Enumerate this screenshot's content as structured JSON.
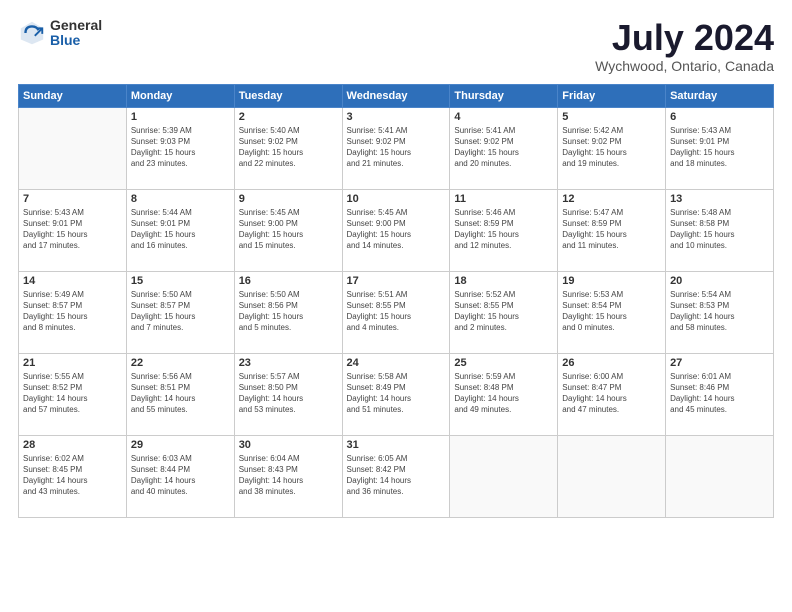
{
  "logo": {
    "general": "General",
    "blue": "Blue"
  },
  "title": "July 2024",
  "location": "Wychwood, Ontario, Canada",
  "days_of_week": [
    "Sunday",
    "Monday",
    "Tuesday",
    "Wednesday",
    "Thursday",
    "Friday",
    "Saturday"
  ],
  "weeks": [
    [
      {
        "day": "",
        "info": ""
      },
      {
        "day": "1",
        "info": "Sunrise: 5:39 AM\nSunset: 9:03 PM\nDaylight: 15 hours\nand 23 minutes."
      },
      {
        "day": "2",
        "info": "Sunrise: 5:40 AM\nSunset: 9:02 PM\nDaylight: 15 hours\nand 22 minutes."
      },
      {
        "day": "3",
        "info": "Sunrise: 5:41 AM\nSunset: 9:02 PM\nDaylight: 15 hours\nand 21 minutes."
      },
      {
        "day": "4",
        "info": "Sunrise: 5:41 AM\nSunset: 9:02 PM\nDaylight: 15 hours\nand 20 minutes."
      },
      {
        "day": "5",
        "info": "Sunrise: 5:42 AM\nSunset: 9:02 PM\nDaylight: 15 hours\nand 19 minutes."
      },
      {
        "day": "6",
        "info": "Sunrise: 5:43 AM\nSunset: 9:01 PM\nDaylight: 15 hours\nand 18 minutes."
      }
    ],
    [
      {
        "day": "7",
        "info": "Sunrise: 5:43 AM\nSunset: 9:01 PM\nDaylight: 15 hours\nand 17 minutes."
      },
      {
        "day": "8",
        "info": "Sunrise: 5:44 AM\nSunset: 9:01 PM\nDaylight: 15 hours\nand 16 minutes."
      },
      {
        "day": "9",
        "info": "Sunrise: 5:45 AM\nSunset: 9:00 PM\nDaylight: 15 hours\nand 15 minutes."
      },
      {
        "day": "10",
        "info": "Sunrise: 5:45 AM\nSunset: 9:00 PM\nDaylight: 15 hours\nand 14 minutes."
      },
      {
        "day": "11",
        "info": "Sunrise: 5:46 AM\nSunset: 8:59 PM\nDaylight: 15 hours\nand 12 minutes."
      },
      {
        "day": "12",
        "info": "Sunrise: 5:47 AM\nSunset: 8:59 PM\nDaylight: 15 hours\nand 11 minutes."
      },
      {
        "day": "13",
        "info": "Sunrise: 5:48 AM\nSunset: 8:58 PM\nDaylight: 15 hours\nand 10 minutes."
      }
    ],
    [
      {
        "day": "14",
        "info": "Sunrise: 5:49 AM\nSunset: 8:57 PM\nDaylight: 15 hours\nand 8 minutes."
      },
      {
        "day": "15",
        "info": "Sunrise: 5:50 AM\nSunset: 8:57 PM\nDaylight: 15 hours\nand 7 minutes."
      },
      {
        "day": "16",
        "info": "Sunrise: 5:50 AM\nSunset: 8:56 PM\nDaylight: 15 hours\nand 5 minutes."
      },
      {
        "day": "17",
        "info": "Sunrise: 5:51 AM\nSunset: 8:55 PM\nDaylight: 15 hours\nand 4 minutes."
      },
      {
        "day": "18",
        "info": "Sunrise: 5:52 AM\nSunset: 8:55 PM\nDaylight: 15 hours\nand 2 minutes."
      },
      {
        "day": "19",
        "info": "Sunrise: 5:53 AM\nSunset: 8:54 PM\nDaylight: 15 hours\nand 0 minutes."
      },
      {
        "day": "20",
        "info": "Sunrise: 5:54 AM\nSunset: 8:53 PM\nDaylight: 14 hours\nand 58 minutes."
      }
    ],
    [
      {
        "day": "21",
        "info": "Sunrise: 5:55 AM\nSunset: 8:52 PM\nDaylight: 14 hours\nand 57 minutes."
      },
      {
        "day": "22",
        "info": "Sunrise: 5:56 AM\nSunset: 8:51 PM\nDaylight: 14 hours\nand 55 minutes."
      },
      {
        "day": "23",
        "info": "Sunrise: 5:57 AM\nSunset: 8:50 PM\nDaylight: 14 hours\nand 53 minutes."
      },
      {
        "day": "24",
        "info": "Sunrise: 5:58 AM\nSunset: 8:49 PM\nDaylight: 14 hours\nand 51 minutes."
      },
      {
        "day": "25",
        "info": "Sunrise: 5:59 AM\nSunset: 8:48 PM\nDaylight: 14 hours\nand 49 minutes."
      },
      {
        "day": "26",
        "info": "Sunrise: 6:00 AM\nSunset: 8:47 PM\nDaylight: 14 hours\nand 47 minutes."
      },
      {
        "day": "27",
        "info": "Sunrise: 6:01 AM\nSunset: 8:46 PM\nDaylight: 14 hours\nand 45 minutes."
      }
    ],
    [
      {
        "day": "28",
        "info": "Sunrise: 6:02 AM\nSunset: 8:45 PM\nDaylight: 14 hours\nand 43 minutes."
      },
      {
        "day": "29",
        "info": "Sunrise: 6:03 AM\nSunset: 8:44 PM\nDaylight: 14 hours\nand 40 minutes."
      },
      {
        "day": "30",
        "info": "Sunrise: 6:04 AM\nSunset: 8:43 PM\nDaylight: 14 hours\nand 38 minutes."
      },
      {
        "day": "31",
        "info": "Sunrise: 6:05 AM\nSunset: 8:42 PM\nDaylight: 14 hours\nand 36 minutes."
      },
      {
        "day": "",
        "info": ""
      },
      {
        "day": "",
        "info": ""
      },
      {
        "day": "",
        "info": ""
      }
    ]
  ]
}
